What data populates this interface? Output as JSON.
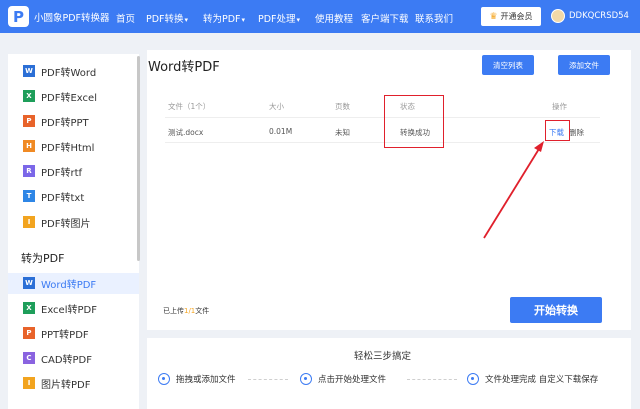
{
  "brand": {
    "name": "小圆象PDF转换器"
  },
  "nav": {
    "items": [
      {
        "label": "首页",
        "caret": ""
      },
      {
        "label": "PDF转换",
        "caret": "▾"
      },
      {
        "label": "转为PDF",
        "caret": "▾"
      },
      {
        "label": "PDF处理",
        "caret": "▾"
      },
      {
        "label": "使用教程",
        "caret": ""
      },
      {
        "label": "客户端下载",
        "caret": ""
      },
      {
        "label": "联系我们",
        "caret": ""
      }
    ],
    "vip_label": "开通会员",
    "username": "DDKQCRSD54"
  },
  "sidebar": {
    "pdf_to": [
      {
        "label": "PDF转Word",
        "icon": "W"
      },
      {
        "label": "PDF转Excel",
        "icon": "X"
      },
      {
        "label": "PDF转PPT",
        "icon": "P"
      },
      {
        "label": "PDF转Html",
        "icon": "H"
      },
      {
        "label": "PDF转rtf",
        "icon": "R"
      },
      {
        "label": "PDF转txt",
        "icon": "T"
      },
      {
        "label": "PDF转图片",
        "icon": "I"
      }
    ],
    "section_title": "转为PDF",
    "to_pdf": [
      {
        "label": "Word转PDF",
        "icon": "W"
      },
      {
        "label": "Excel转PDF",
        "icon": "X"
      },
      {
        "label": "PPT转PDF",
        "icon": "P"
      },
      {
        "label": "CAD转PDF",
        "icon": "C"
      },
      {
        "label": "图片转PDF",
        "icon": "I"
      }
    ]
  },
  "main": {
    "title": "Word转PDF",
    "clear_label": "清空列表",
    "add_label": "添加文件",
    "table": {
      "headers": {
        "file": "文件（1个）",
        "size": "大小",
        "pages": "页数",
        "status": "状态",
        "action": "操作"
      },
      "row": {
        "file": "测试.docx",
        "size": "0.01M",
        "pages": "未知",
        "status": "转换成功",
        "download": "下载",
        "delete": "删除"
      }
    },
    "uploaded_prefix": "已上传",
    "uploaded_count": "1/1",
    "uploaded_suffix": "文件",
    "start_label": "开始转换"
  },
  "steps": {
    "title": "轻松三步搞定",
    "items": [
      "拖拽或添加文件",
      "点击开始处理文件",
      "文件处理完成 自定义下载保存"
    ]
  },
  "colors": {
    "accent": "#3c7bf3",
    "annotation": "#e0202c"
  }
}
